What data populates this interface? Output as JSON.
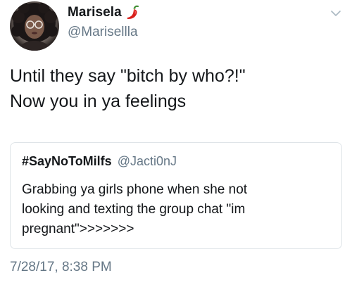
{
  "author": {
    "display_name": "Marisela",
    "handle": "@Marisellla",
    "emoji_icon": "hot-pepper-icon"
  },
  "tweet": {
    "lines": [
      "Until they say \"bitch by who?!\"",
      "Now you in ya feelings"
    ]
  },
  "quoted_tweet": {
    "display_name": "#SayNoToMilfs",
    "handle": "@Jacti0nJ",
    "lines": [
      "Grabbing ya girls phone when she not",
      "looking and texting the group chat \"im",
      "pregnant\">>>>>>>"
    ]
  },
  "timestamp": "7/28/17, 8:38 PM",
  "colors": {
    "text": "#14171a",
    "secondary": "#657786",
    "border": "#dfe4e8"
  }
}
